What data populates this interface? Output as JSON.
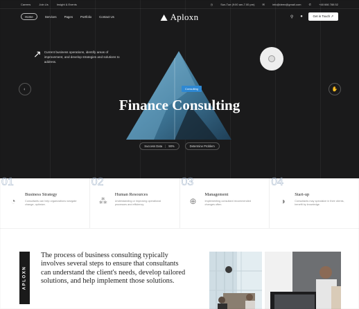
{
  "topbar": {
    "left": [
      "Careers",
      "Join Us",
      "Insight & Events"
    ],
    "hours": "Sun-Tue (9:00 am-7.00 pm)",
    "email": "info@deex@gmail.com",
    "phone": "+48 666 788 52"
  },
  "nav": {
    "links": [
      "Home",
      "Services",
      "Pages",
      "Portfolio",
      "Contact Us"
    ],
    "brand": "Aploxn",
    "cta": "Get in Touch ↗"
  },
  "hero": {
    "intro": "Current business operations, identify areas of improvement, and develop strategies and solutions to address.",
    "tag": "Consulting",
    "headline": "Finance Consulting",
    "pill1_label": "Success Data",
    "pill1_value": "90%",
    "pill2_label": "Determine Problem"
  },
  "services": [
    {
      "num": "01",
      "title": "Business Strategy",
      "desc": "Consultants can help organizations navigate change, optimize.",
      "icon": "pie-chart-icon"
    },
    {
      "num": "02",
      "title": "Human Resources",
      "desc": "Understanding or improving operational processes and efficiency.",
      "icon": "circles-icon"
    },
    {
      "num": "03",
      "title": "Management",
      "desc": "Implementing consultant recommended changes often.",
      "icon": "crosshair-icon"
    },
    {
      "num": "04",
      "title": "Start-up",
      "desc": "Consultants may specialize in their clients, benefit by knowledge.",
      "icon": "half-circle-icon"
    }
  ],
  "about": {
    "vertical_logo": "APLOXN",
    "paragraph": "The process of business consulting typically involves several steps to ensure that consultants can understand the client's needs, develop tailored solutions, and help implement those solutions."
  },
  "colors": {
    "hero_bg": "#1a1a1b",
    "accent": "#2e88d3",
    "triangle": "#4b87a9"
  }
}
